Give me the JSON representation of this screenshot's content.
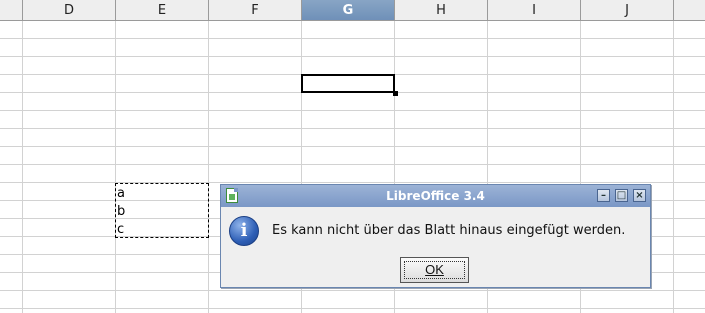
{
  "spreadsheet": {
    "columns": [
      "D",
      "E",
      "F",
      "G",
      "H",
      "I",
      "J"
    ],
    "selected_column": "G",
    "cells": [
      "a",
      "b",
      "c"
    ]
  },
  "dialog": {
    "title": "LibreOffice 3.4",
    "message": "Es kann nicht über das Blatt hinaus eingefügt werden.",
    "ok_label": "OK",
    "title_buttons": [
      "minimize",
      "maximize",
      "close"
    ]
  },
  "colors": {
    "titlebar": "#7a97c6",
    "selected_header": "#6f90b8",
    "grid": "#d2d2d2"
  }
}
